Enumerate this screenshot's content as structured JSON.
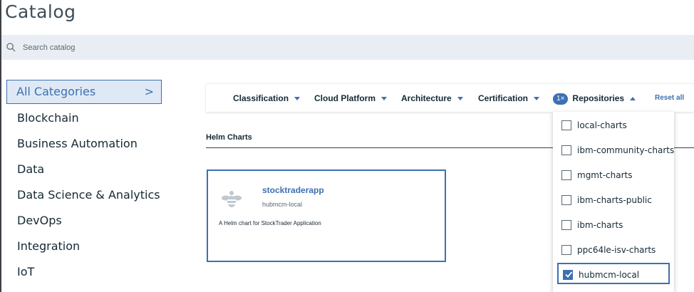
{
  "page": {
    "title": "Catalog"
  },
  "search": {
    "placeholder": "Search catalog",
    "value": ""
  },
  "categories": [
    {
      "label": "All Categories",
      "selected": true
    },
    {
      "label": "Blockchain"
    },
    {
      "label": "Business Automation"
    },
    {
      "label": "Data"
    },
    {
      "label": "Data Science & Analytics"
    },
    {
      "label": "DevOps"
    },
    {
      "label": "Integration"
    },
    {
      "label": "IoT"
    }
  ],
  "category_chevron": ">",
  "filters": {
    "classification": "Classification",
    "cloud_platform": "Cloud Platform",
    "architecture": "Architecture",
    "certification": "Certification",
    "repositories": "Repositories",
    "repositories_count": "1",
    "badge_clear": "×",
    "reset": "Reset all"
  },
  "section": {
    "title": "Helm Charts"
  },
  "tile": {
    "name": "stocktraderapp",
    "repo": "hubmcm-local",
    "description": "A Helm chart for StockTrader Application",
    "icon": "helm-bee-icon"
  },
  "repositories": [
    {
      "label": "local-charts",
      "checked": false
    },
    {
      "label": "ibm-community-charts",
      "checked": false
    },
    {
      "label": "mgmt-charts",
      "checked": false
    },
    {
      "label": "ibm-charts-public",
      "checked": false
    },
    {
      "label": "ibm-charts",
      "checked": false
    },
    {
      "label": "ppc64le-isv-charts",
      "checked": false
    },
    {
      "label": "hubmcm-local",
      "checked": true
    }
  ],
  "colors": {
    "accent": "#3d70b2",
    "search_bg": "#e9eef4",
    "selected_bg": "#dfe9f5"
  }
}
